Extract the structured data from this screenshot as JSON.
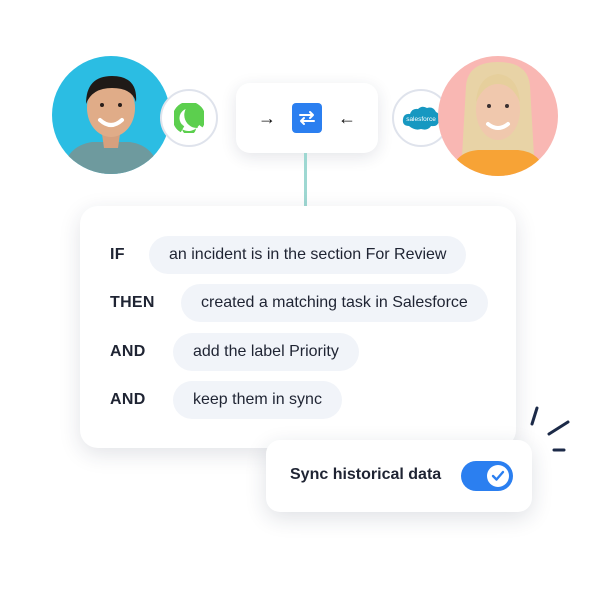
{
  "people": {
    "left": {
      "name": "left-user",
      "background": "#2bbde3"
    },
    "right": {
      "name": "right-user",
      "background": "#f9b7b3"
    }
  },
  "integrations": {
    "left_logo": "green-ring-logo",
    "right_logo": "salesforce-logo",
    "right_logo_text": "salesforce"
  },
  "connector": {
    "left_arrow": "→",
    "right_arrow": "←",
    "sync_icon": "swap-arrows-icon",
    "accent": "#2b7ff0"
  },
  "rules": [
    {
      "keyword": "IF",
      "text": "an incident is in the section For Review"
    },
    {
      "keyword": "THEN",
      "text": "created a matching task in Salesforce"
    },
    {
      "keyword": "AND",
      "text": "add the label Priority"
    },
    {
      "keyword": "AND",
      "text": "keep them in sync"
    }
  ],
  "sync_option": {
    "label": "Sync historical data",
    "enabled": true
  }
}
